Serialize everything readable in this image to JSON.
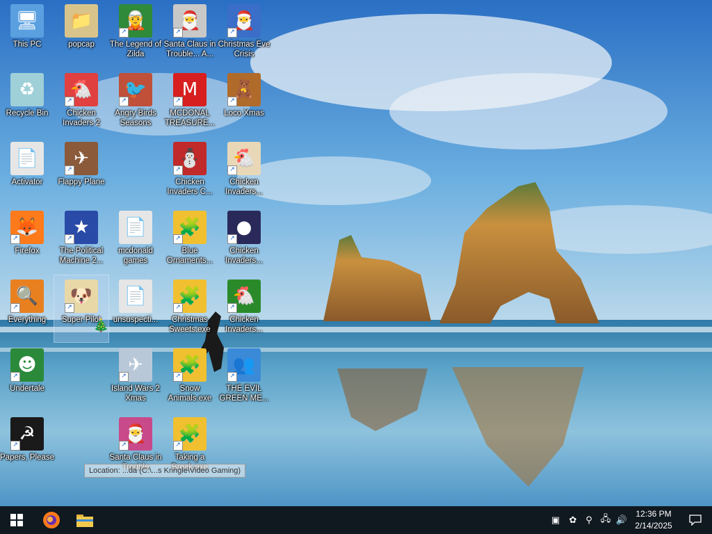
{
  "desktop": {
    "icons": [
      {
        "name": "icon-this-pc",
        "label": "This PC",
        "symbol": "🖥",
        "bg": "#5aa0e0",
        "shortcut": false
      },
      {
        "name": "icon-popcap",
        "label": "popcap",
        "symbol": "📁",
        "bg": "#d8c48a",
        "shortcut": false
      },
      {
        "name": "icon-legend-of-zilda",
        "label": "The Legend of Zilda",
        "symbol": "🧝",
        "bg": "#2f8a3a",
        "shortcut": true
      },
      {
        "name": "icon-santa-claus-trouble-a",
        "label": "Santa Claus in Trouble... A...",
        "symbol": "🎅",
        "bg": "#c8c8c8",
        "shortcut": true
      },
      {
        "name": "icon-christmas-eve-crisis",
        "label": "Christmas Eve Crisis",
        "symbol": "🎅",
        "bg": "#3a6ec8",
        "shortcut": true
      },
      {
        "name": "icon-recycle-bin",
        "label": "Recycle Bin",
        "symbol": "♻",
        "bg": "#9fd0d8",
        "shortcut": false
      },
      {
        "name": "icon-chicken-invaders-2",
        "label": "Chicken Invaders 2",
        "symbol": "🐔",
        "bg": "#e04040",
        "shortcut": true
      },
      {
        "name": "icon-angry-birds-seasons",
        "label": "Angry Birds Seasons",
        "symbol": "🐦",
        "bg": "#c0503a",
        "shortcut": true
      },
      {
        "name": "icon-mcdonal-treasure",
        "label": "MCDONAL TREASURE...",
        "symbol": "M",
        "bg": "#d81f1f",
        "shortcut": true
      },
      {
        "name": "icon-loco-xmas",
        "label": "Loco Xmas",
        "symbol": "🧸",
        "bg": "#b06a2a",
        "shortcut": true
      },
      {
        "name": "icon-activator",
        "label": "Activator",
        "symbol": "📄",
        "bg": "#e6e6e6",
        "shortcut": false
      },
      {
        "name": "icon-flappy-plane",
        "label": "Flappy Plane",
        "symbol": "✈",
        "bg": "#8a5a3a",
        "shortcut": true
      },
      {
        "name": "icon-chicken-invaders-c",
        "label": "Chicken Invaders C...",
        "symbol": "⛄",
        "bg": "#c02a2a",
        "shortcut": true
      },
      {
        "name": "icon-chicken-invaders-a",
        "label": "Chicken Invaders...",
        "symbol": "🐔",
        "bg": "#e8d8b8",
        "shortcut": true
      },
      {
        "name": "icon-firefox",
        "label": "Firefox",
        "symbol": "🦊",
        "bg": "#ff7a1a",
        "shortcut": true
      },
      {
        "name": "icon-political-machine",
        "label": "The Political Machine 2...",
        "symbol": "★",
        "bg": "#2a4aa8",
        "shortcut": true
      },
      {
        "name": "icon-mcdonald-games",
        "label": "mcdonald games",
        "symbol": "📄",
        "bg": "#e6e6e6",
        "shortcut": false
      },
      {
        "name": "icon-blue-ornaments",
        "label": "Blue Ornaments...",
        "symbol": "🧩",
        "bg": "#f0c030",
        "shortcut": true
      },
      {
        "name": "icon-chicken-invaders-b",
        "label": "Chicken Invaders...",
        "symbol": "●",
        "bg": "#2a2a5a",
        "shortcut": true
      },
      {
        "name": "icon-everything",
        "label": "Everything",
        "symbol": "🔍",
        "bg": "#e88020",
        "shortcut": true
      },
      {
        "name": "icon-super-pilot",
        "label": "Super Pilot",
        "symbol": "🐶",
        "bg": "#e8d8a8",
        "shortcut": true
      },
      {
        "name": "icon-unsuspecting",
        "label": "unsuspecti...",
        "symbol": "📄",
        "bg": "#e6e6e6",
        "shortcut": false
      },
      {
        "name": "icon-christmas-sweets",
        "label": "Christmas Sweets.exe",
        "symbol": "🧩",
        "bg": "#f0c030",
        "shortcut": true
      },
      {
        "name": "icon-chicken-invaders-c2",
        "label": "Chicken Invaders...",
        "symbol": "🐔",
        "bg": "#2a8a2a",
        "shortcut": true
      },
      {
        "name": "icon-undertale",
        "label": "Undertale",
        "symbol": "☻",
        "bg": "#2a8a3a",
        "shortcut": true
      },
      {
        "name": "icon-island-wars-2-xmas",
        "label": "Island Wars 2 Xmas",
        "symbol": "✈",
        "bg": "#b8c8d8",
        "shortcut": true
      },
      {
        "name": "icon-snow-animals",
        "label": "Snow Animals.exe",
        "symbol": "🧩",
        "bg": "#f0c030",
        "shortcut": true
      },
      {
        "name": "icon-evil-green-me",
        "label": "THE EVIL GREEN ME...",
        "symbol": "👥",
        "bg": "#3a8ad8",
        "shortcut": true
      },
      {
        "name": "icon-papers-please",
        "label": "Papers, Please",
        "symbol": "☭",
        "bg": "#1a1a1a",
        "shortcut": true
      },
      {
        "name": "icon-santa-claus-trouble",
        "label": "Santa Claus in Trouble",
        "symbol": "🎅",
        "bg": "#c84a8a",
        "shortcut": true
      },
      {
        "name": "icon-taking-a-break",
        "label": "Taking a Break.exe",
        "symbol": "🧩",
        "bg": "#f0c030",
        "shortcut": true
      }
    ],
    "tooltip": "Location: ...da (C:\\...s Kringle\\Video Gaming)"
  },
  "taskbar": {
    "start_icon": "windows-logo",
    "pinned": [
      {
        "name": "firefox",
        "icon": "firefox-icon",
        "color": "#ff7a1a"
      },
      {
        "name": "file-explorer",
        "icon": "folder-icon",
        "color": "#f2c94c"
      }
    ],
    "tray": [
      {
        "name": "tray-app-icon-1",
        "symbol": "▣"
      },
      {
        "name": "tray-app-icon-2",
        "symbol": "✿"
      },
      {
        "name": "tray-search-everything-icon",
        "symbol": "⚲"
      },
      {
        "name": "tray-network-icon",
        "symbol": "🖧"
      },
      {
        "name": "tray-volume-icon",
        "symbol": "🔊"
      }
    ],
    "clock": {
      "time": "12:36 PM",
      "date": "2/14/2025"
    }
  }
}
